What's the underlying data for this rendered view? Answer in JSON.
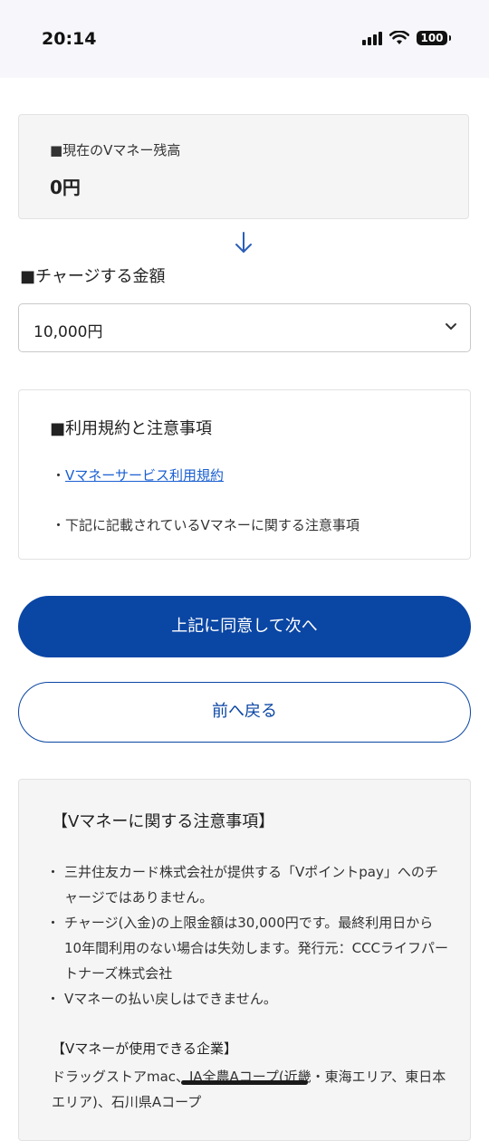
{
  "status_bar": {
    "time": "20:14",
    "battery": "100"
  },
  "balance": {
    "label": "■現在のVマネー残高",
    "value": "0円"
  },
  "charge": {
    "label": "■チャージする金額",
    "selected": "10,000円"
  },
  "terms": {
    "title": "■利用規約と注意事項",
    "link_prefix": "・",
    "link_label": "Vマネーサービス利用規約",
    "note_line": "・下記に記載されているVマネーに関する注意事項"
  },
  "buttons": {
    "agree_next": "上記に同意して次へ",
    "back": "前へ戻る"
  },
  "notes": {
    "title": "【Vマネーに関する注意事項】",
    "items": [
      "三井住友カード株式会社が提供する「Vポイントpay」へのチャージではありません。",
      "チャージ(入金)の上限金額は30,000円です。最終利用日から10年間利用のない場合は失効します。発行元：CCCライフパートナーズ株式会社",
      "Vマネーの払い戻しはできません。"
    ],
    "companies_title": "【Vマネーが使用できる企業】",
    "companies_text": "ドラッグストアmac、JA全農Aコープ(近畿・東海エリア、東日本エリア)、石川県Aコープ"
  },
  "icons": {
    "arrow": "arrow-down-icon",
    "chevron": "chevron-down-icon"
  },
  "colors": {
    "primary": "#0a46a4",
    "link": "#1a5fd1"
  }
}
